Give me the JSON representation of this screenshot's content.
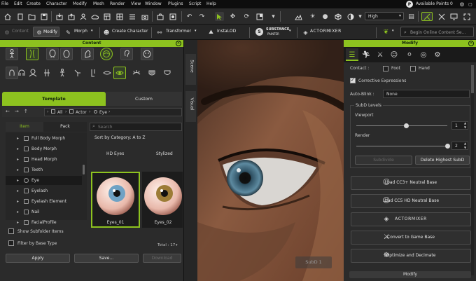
{
  "menubar": {
    "items": [
      "File",
      "Edit",
      "Create",
      "Character",
      "Modify",
      "Mesh",
      "Render",
      "View",
      "Window",
      "Plugins",
      "Script",
      "Help"
    ],
    "points_label": "Available Points",
    "points_value": "0"
  },
  "toolbar1": {
    "quality_select": "High"
  },
  "toolbar2": {
    "content_label": "Content",
    "modify_label": "Modify",
    "morph_label": "Morph",
    "create_character_label": "Create Character",
    "transformer_label": "Transformer",
    "instalod_label": "InstaLOD",
    "substance_label": "SUBSTANCE",
    "substance_sub": "PAINTER",
    "actormixer_label": "ACTORMIXER",
    "search_placeholder": "Begin Online Content Se..."
  },
  "content_panel": {
    "title": "Content",
    "side_tabs": [
      "Scene",
      "Visual"
    ],
    "tabs": [
      "Template",
      "Custom"
    ],
    "breadcrumb": [
      "All",
      "Actor",
      "Eye"
    ],
    "item_tabs": [
      "Item",
      "Pack"
    ],
    "search_placeholder": "Search",
    "sort_label": "Sort by Category: A to Z",
    "tree": [
      {
        "label": "Full Body Morph",
        "selected": false
      },
      {
        "label": "Body Morph",
        "selected": false
      },
      {
        "label": "Head Morph",
        "selected": false
      },
      {
        "label": "Teeth",
        "selected": false
      },
      {
        "label": "Eye",
        "selected": true
      },
      {
        "label": "Eyelash",
        "selected": false
      },
      {
        "label": "Eyelash Element",
        "selected": false
      },
      {
        "label": "Nail",
        "selected": false
      },
      {
        "label": "FacialProfile",
        "selected": false
      }
    ],
    "columns": [
      "HD Eyes",
      "Stylized"
    ],
    "thumbs": [
      {
        "label": "Eyes_01",
        "iris": "#6fa2c4",
        "selected": true
      },
      {
        "label": "Eyes_02",
        "iris": "#9c7c36",
        "selected": false
      }
    ],
    "total_label": "Total : 17",
    "show_subfolder": "Show Subfolder Items",
    "filter_base": "Filter by Base Type",
    "apply_label": "Apply",
    "save_label": "Save...",
    "download_label": "Download"
  },
  "viewport": {
    "subd_label": "SubD 1"
  },
  "modify_panel": {
    "title": "Modify",
    "contact_label": "Contact :",
    "foot_label": "Foot",
    "hand_label": "Hand",
    "corrective_label": "Corrective Expressions",
    "autoblink_label": "Auto-Blink :",
    "autoblink_value": "None",
    "subd_group": "SubD Levels",
    "viewport_label": "Viewport",
    "viewport_value": "1",
    "viewport_level": 0.55,
    "render_label": "Render",
    "render_value": "2",
    "render_level": 1.0,
    "subdivide_label": "Subdivide",
    "delete_subd_label": "Delete Highest SubD",
    "buttons": [
      "Load CC3+ Neutral Base",
      "Load CC5 HD Neutral Base",
      "ACTORMIXER",
      "Convert to Game Base",
      "Optimize and Decimate"
    ],
    "footer": "Modify"
  },
  "colors": {
    "accent": "#8dc21f",
    "panel": "#2b2b2b",
    "menubar": "#0d0d0d"
  }
}
